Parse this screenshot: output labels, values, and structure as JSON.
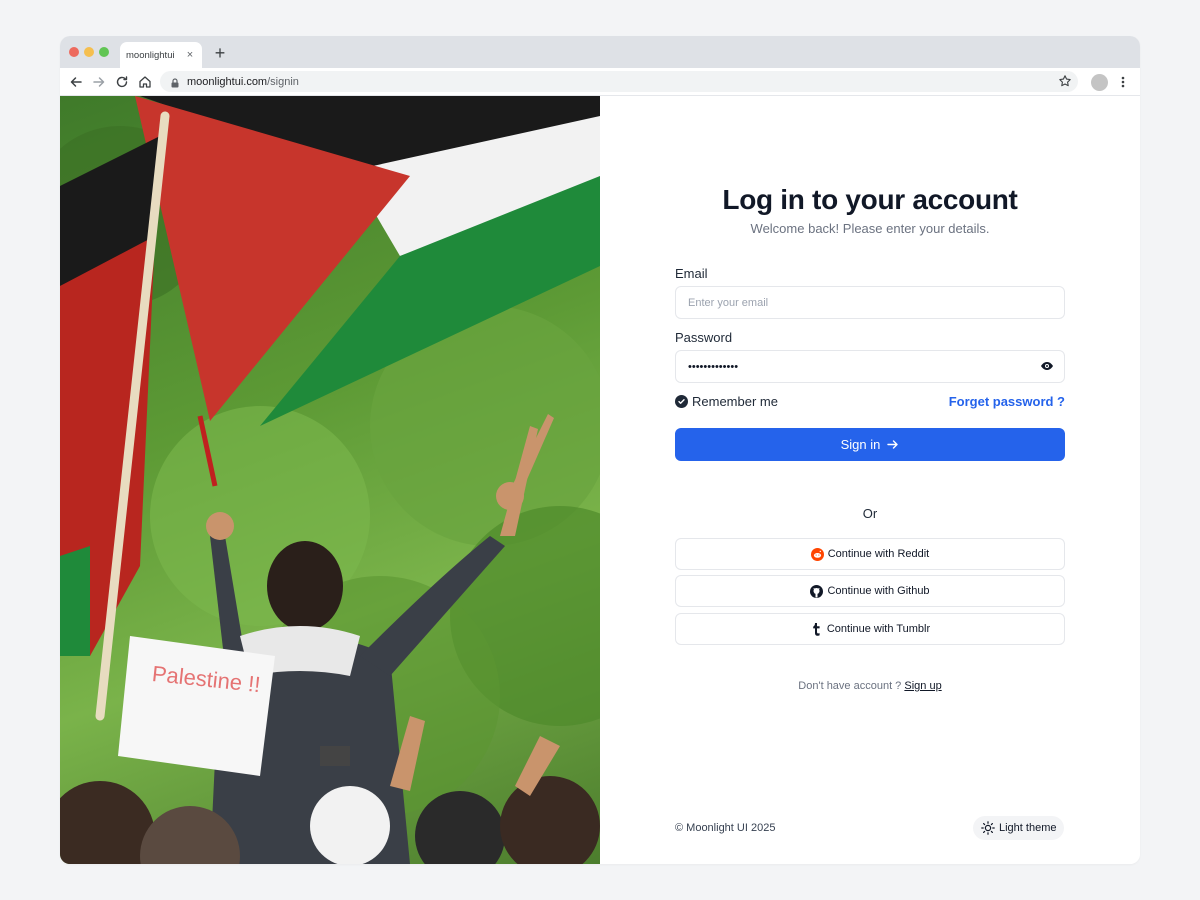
{
  "browser": {
    "tab_title": "moonlightui",
    "tab_close": "×",
    "new_tab": "+",
    "url_domain": "moonlightui.com",
    "url_path": "/signin"
  },
  "hero": {
    "sign_text": "Palestine !!"
  },
  "form": {
    "title": "Log in to your account",
    "subtitle": "Welcome back! Please enter your details.",
    "email_label": "Email",
    "email_placeholder": "Enter your email",
    "password_label": "Password",
    "password_value": "•••••••••••••",
    "remember_label": "Remember me",
    "remember_checked": true,
    "forgot_label": "Forget password ?",
    "signin_label": "Sign in",
    "or_label": "Or",
    "social": [
      {
        "label": "Continue with Reddit",
        "icon": "reddit-icon"
      },
      {
        "label": "Continue with Github",
        "icon": "github-icon"
      },
      {
        "label": "Continue with Tumblr",
        "icon": "tumblr-icon"
      }
    ],
    "no_account_text": "Don't have account ?",
    "signup_label": "Sign up"
  },
  "footer": {
    "copyright": "© Moonlight UI 2025",
    "theme_label": "Light theme"
  },
  "colors": {
    "primary": "#2563eb",
    "text": "#111827",
    "muted": "#6b7280",
    "border": "#e5e7eb",
    "reddit": "#ff4500"
  }
}
